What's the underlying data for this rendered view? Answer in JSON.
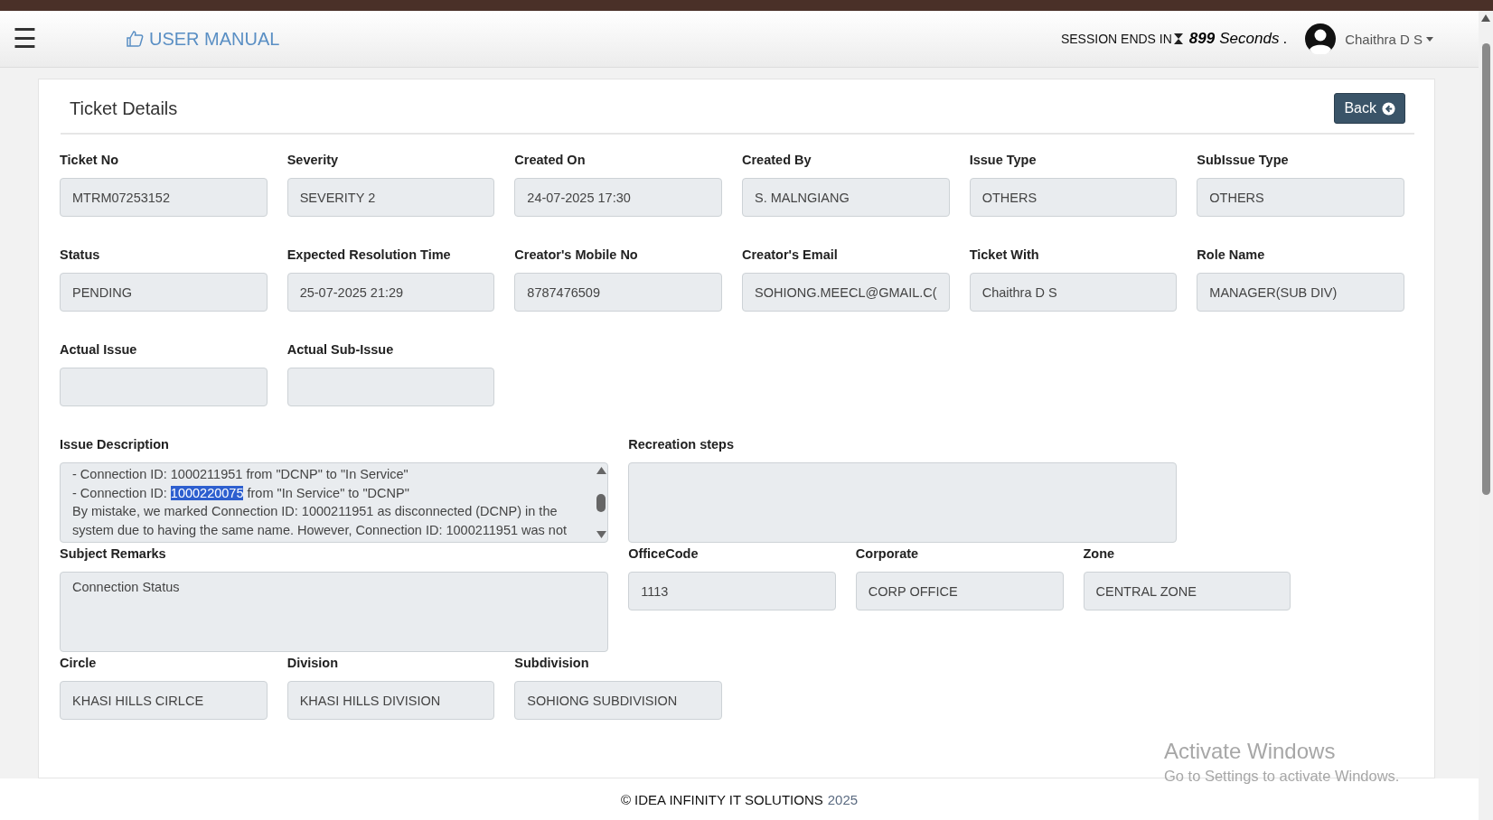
{
  "header": {
    "menu_icon": "☰",
    "manual_link": "USER MANUAL",
    "session_label": "SESSION ENDS IN",
    "session_count": "899",
    "session_unit": "Seconds",
    "session_dot": ".",
    "user_name": "Chaithra D S"
  },
  "card": {
    "title": "Ticket Details",
    "back_button": "Back",
    "rows": [
      [
        {
          "label": "Ticket No",
          "value": "MTRM07253152",
          "kind": "input"
        },
        {
          "label": "Severity",
          "value": "SEVERITY 2",
          "kind": "input"
        },
        {
          "label": "Created On",
          "value": "24-07-2025 17:30",
          "kind": "input"
        },
        {
          "label": "Created By",
          "value": "S. MALNGIANG",
          "kind": "input"
        },
        {
          "label": "Issue Type",
          "value": "OTHERS",
          "kind": "input"
        },
        {
          "label": "SubIssue Type",
          "value": "OTHERS",
          "kind": "input"
        }
      ],
      [
        {
          "label": "Status",
          "value": "PENDING",
          "kind": "input"
        },
        {
          "label": "Expected Resolution Time",
          "value": "25-07-2025 21:29",
          "kind": "input"
        },
        {
          "label": "Creator's Mobile No",
          "value": "8787476509",
          "kind": "input"
        },
        {
          "label": "Creator's Email",
          "value": "SOHIONG.MEECL@GMAIL.C(",
          "kind": "input"
        },
        {
          "label": "Ticket With",
          "value": "Chaithra D S",
          "kind": "input"
        },
        {
          "label": "Role Name",
          "value": "MANAGER(SUB DIV)",
          "kind": "input"
        }
      ],
      [
        {
          "label": "Actual Issue",
          "kind": "input"
        },
        {
          "label": "Actual Sub-Issue",
          "kind": "input"
        }
      ],
      [
        {
          "label": "Issue Description",
          "kind": "scroll",
          "lines": [
            [
              {
                "text": "- Connection ID: 1000211951 from \"DCNP\" to \"In Service\"",
                "selected": false
              }
            ],
            [
              {
                "text": "- Connection ID: ",
                "selected": false
              },
              {
                "text": "1000220075",
                "selected": true
              },
              {
                "text": " from \"In Service\" to \"DCNP\"",
                "selected": false
              }
            ],
            [
              {
                "text": "By mistake, we marked Connection ID: 1000211951 as disconnected (DCNP) in the",
                "selected": false
              }
            ],
            [
              {
                "text": "system due to having the same name. However, Connection ID: 1000211951 was not",
                "selected": false
              }
            ]
          ]
        },
        {
          "label": "Recreation steps",
          "kind": "textarea"
        }
      ],
      [
        {
          "label": "Subject Remarks",
          "value": "Connection Status",
          "kind": "textarea"
        },
        {
          "label": "OfficeCode",
          "value": "1113",
          "kind": "input"
        },
        {
          "label": "Corporate",
          "value": "CORP OFFICE",
          "kind": "input"
        },
        {
          "label": "Zone",
          "value": "CENTRAL ZONE",
          "kind": "input"
        }
      ],
      [
        {
          "label": "Circle",
          "value": "KHASI HILLS CIRLCE",
          "kind": "input"
        },
        {
          "label": "Division",
          "value": "KHASI HILLS DIVISION",
          "kind": "input"
        },
        {
          "label": "Subdivision",
          "value": "SOHIONG SUBDIVISION",
          "kind": "input"
        }
      ]
    ]
  },
  "os_notice": {
    "title": "Activate Windows",
    "text": "Go to Settings to activate Windows."
  },
  "footer": {
    "company": "© IDEA INFINITY IT SOLUTIONS",
    "year": "2025"
  }
}
